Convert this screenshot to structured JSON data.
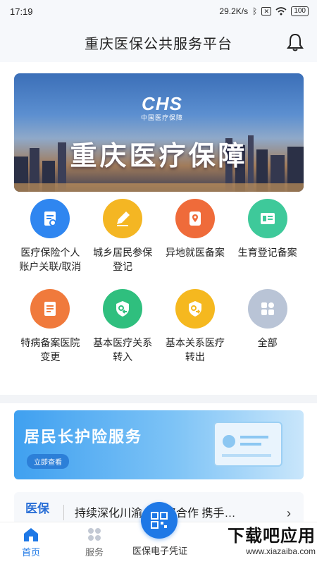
{
  "status_bar": {
    "time": "17:19",
    "speed": "29.2K/s",
    "battery": "100",
    "sim_icon": "sim-off-icon",
    "wifi_icon": "wifi-icon",
    "bt_icon": "bluetooth-icon"
  },
  "header": {
    "title": "重庆医保公共服务平台",
    "bell_icon": "bell-icon"
  },
  "banner": {
    "logo": "CHS",
    "logo_sub": "中国医疗保障",
    "title": "重庆医疗保障"
  },
  "services": [
    {
      "label": "医疗保险个人账户关联/取消",
      "icon": "document-link-icon",
      "color": "#2f86f0"
    },
    {
      "label": "城乡居民参保登记",
      "icon": "edit-pencil-icon",
      "color": "#f4b623"
    },
    {
      "label": "异地就医备案",
      "icon": "location-pin-icon",
      "color": "#ef6b3a"
    },
    {
      "label": "生育登记备案",
      "icon": "id-card-icon",
      "color": "#3ec99a"
    },
    {
      "label": "特病备案医院变更",
      "icon": "form-icon",
      "color": "#f07a3c"
    },
    {
      "label": "基本医疗关系转入",
      "icon": "shield-in-icon",
      "color": "#2fbf7e"
    },
    {
      "label": "基本关系医疗转出",
      "icon": "shield-out-icon",
      "color": "#f5b81f"
    },
    {
      "label": "全部",
      "icon": "grid-all-icon",
      "color": "#b9c4d6"
    }
  ],
  "promo": {
    "title": "居民长护险服务",
    "button": "立即查看"
  },
  "news": {
    "tag": "医保\n快讯",
    "text": "持续深化川渝…战略合作 携手…",
    "arrow": "›"
  },
  "nav": {
    "home": "首页",
    "services": "服务",
    "voucher": "医保电子凭证"
  },
  "watermark": {
    "main": "下载吧应用",
    "sub": "www.xiazaiba.com"
  }
}
